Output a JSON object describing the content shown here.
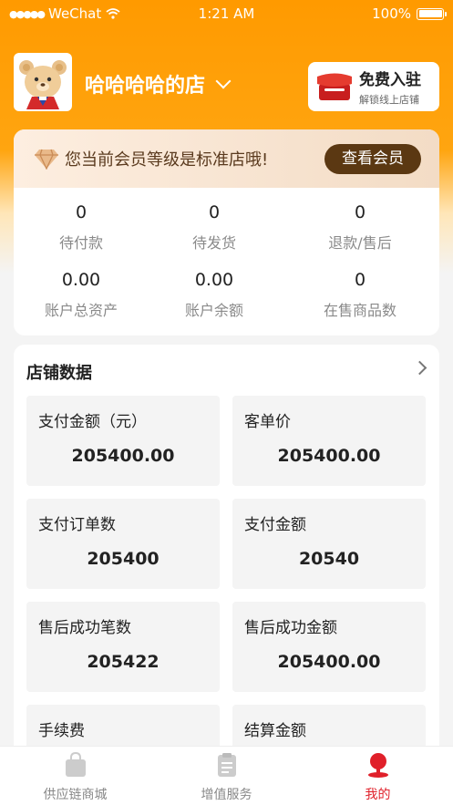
{
  "status_bar": {
    "carrier": "WeChat",
    "time": "1:21 AM",
    "battery": "100%"
  },
  "shop": {
    "name": "哈哈哈哈的店"
  },
  "free_entry": {
    "title": "免费入驻",
    "subtitle": "解锁线上店铺"
  },
  "member": {
    "message": "您当前会员等级是标准店哦!",
    "button": "查看会员"
  },
  "stats": [
    {
      "value": "0",
      "label": "待付款"
    },
    {
      "value": "0",
      "label": "待发货"
    },
    {
      "value": "0",
      "label": "退款/售后"
    },
    {
      "value": "0.00",
      "label": "账户总资产"
    },
    {
      "value": "0.00",
      "label": "账户余额"
    },
    {
      "value": "0",
      "label": "在售商品数"
    }
  ],
  "store_data": {
    "title": "店铺数据",
    "tiles": [
      {
        "label": "支付金额（元）",
        "value": "205400.00"
      },
      {
        "label": "客单价",
        "value": "205400.00"
      },
      {
        "label": "支付订单数",
        "value": "205400"
      },
      {
        "label": "支付金额",
        "value": "20540"
      },
      {
        "label": "售后成功笔数",
        "value": "205422"
      },
      {
        "label": "售后成功金额",
        "value": "205400.00"
      },
      {
        "label": "手续费",
        "value": ""
      },
      {
        "label": "结算金额",
        "value": ""
      }
    ]
  },
  "tabs": [
    {
      "label": "供应链商城",
      "icon": "shopping-bag-icon"
    },
    {
      "label": "增值服务",
      "icon": "clipboard-icon"
    },
    {
      "label": "我的",
      "icon": "user-icon"
    }
  ],
  "colors": {
    "brand_orange": "#ff9a00",
    "active_red": "#e0202a",
    "member_brown": "#5b3812"
  }
}
